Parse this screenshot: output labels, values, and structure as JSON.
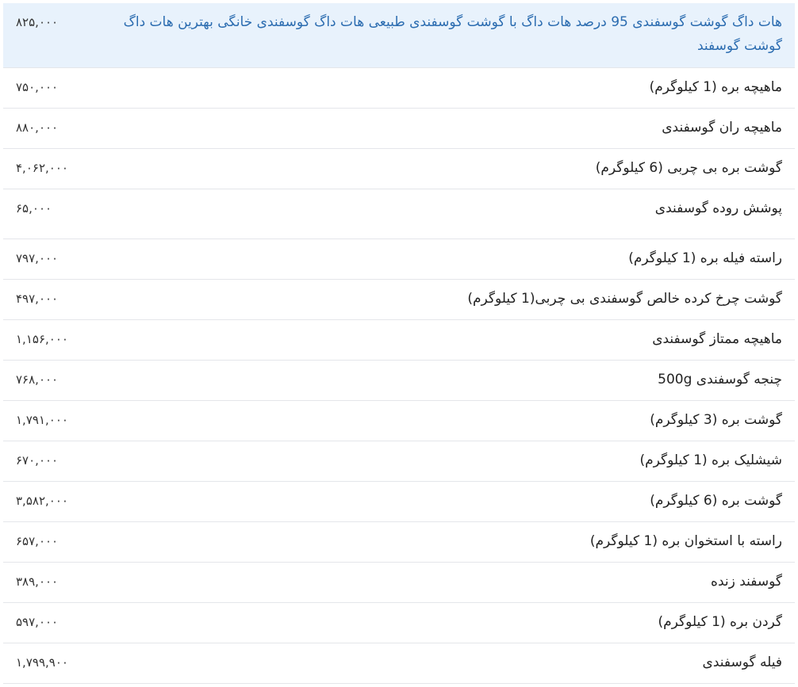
{
  "products": [
    {
      "name": "هات داگ گوشت گوسفندی 95 درصد هات داگ با گوشت گوسفندی طبیعی هات داگ گوسفندی خانگی بهترین هات داگ گوشت گوسفند",
      "price": "۸۲۵,۰۰۰"
    },
    {
      "name": "ماهیچه بره (1 کیلوگرم)",
      "price": "۷۵۰,۰۰۰"
    },
    {
      "name": "ماهیچه ران گوسفندی",
      "price": "۸۸۰,۰۰۰"
    },
    {
      "name": "گوشت بره بی چربی (6 کیلوگرم)",
      "price": "۴,۰۶۲,۰۰۰"
    },
    {
      "name": "پوشش روده گوسفندی",
      "price": "۶۵,۰۰۰"
    },
    {
      "name": "راسته فیله بره (1 کیلوگرم)",
      "price": "۷۹۷,۰۰۰"
    },
    {
      "name": "گوشت چرخ کرده خالص گوسفندی بی چربی(1 کیلوگرم)",
      "price": "۴۹۷,۰۰۰"
    },
    {
      "name": "ماهیچه ممتاز گوسفندی",
      "price": "۱,۱۵۶,۰۰۰"
    },
    {
      "name": "چنجه گوسفندی 500g",
      "price": "۷۶۸,۰۰۰"
    },
    {
      "name": "گوشت بره (3 کیلوگرم)",
      "price": "۱,۷۹۱,۰۰۰"
    },
    {
      "name": "شیشلیک بره (1 کیلوگرم)",
      "price": "۶۷۰,۰۰۰"
    },
    {
      "name": "گوشت بره (6 کیلوگرم)",
      "price": "۳,۵۸۲,۰۰۰"
    },
    {
      "name": "راسته با استخوان بره (1 کیلوگرم)",
      "price": "۶۵۷,۰۰۰"
    },
    {
      "name": "گوسفند زنده",
      "price": "۳۸۹,۰۰۰"
    },
    {
      "name": "گردن بره (1 کیلوگرم)",
      "price": "۵۹۷,۰۰۰"
    },
    {
      "name": "فیله گوسفندی",
      "price": "۱,۷۹۹,۹۰۰"
    }
  ],
  "colors": {
    "highlight_background": "#e8f2fc",
    "highlight_text": "#2b6cb0",
    "row_border": "#e4e6ea"
  }
}
